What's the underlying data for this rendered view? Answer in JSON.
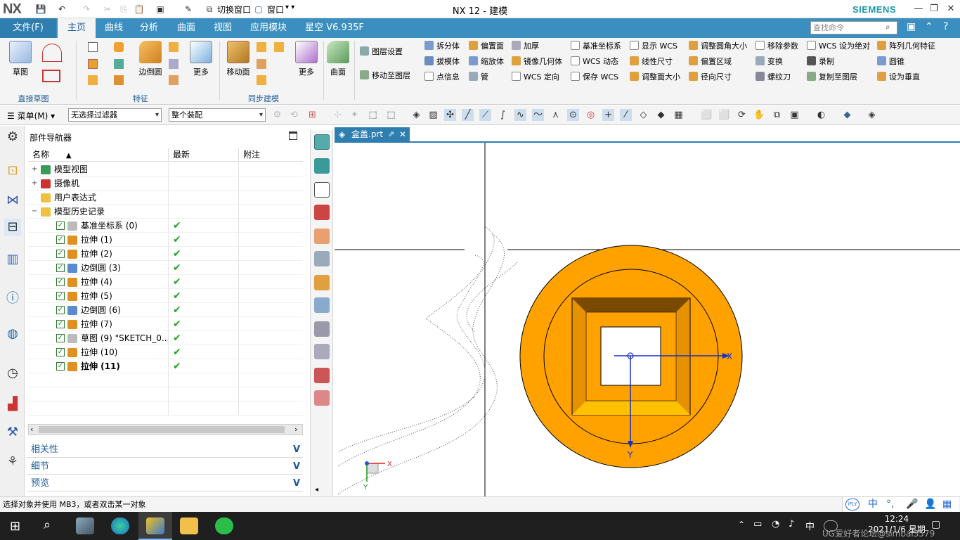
{
  "app": {
    "logo": "NX",
    "title": "NX 12 - 建模",
    "brand": "SIEMENS",
    "switch_window": "切换窗口",
    "window_menu": "窗口"
  },
  "tabs": [
    {
      "label": "文件(F)"
    },
    {
      "label": "主页"
    },
    {
      "label": "曲线"
    },
    {
      "label": "分析"
    },
    {
      "label": "曲面"
    },
    {
      "label": "视图"
    },
    {
      "label": "应用模块"
    },
    {
      "label": "星空 V6.935F"
    }
  ],
  "search": {
    "placeholder": "查找命令"
  },
  "ribbon": {
    "sketch": "草图",
    "edge_blend": "边倒圆",
    "more1": "更多",
    "move_face": "移动面",
    "more2": "更多",
    "surface": "曲面",
    "layer_settings": "图层设置",
    "move_to_layer": "移动至图层",
    "groups": {
      "direct_sketch": "直接草图",
      "feature": "特征",
      "sync_modeling": "同步建模"
    },
    "col1": [
      "拆分体",
      "拔模体",
      "点信息"
    ],
    "col2": [
      "偏置面",
      "缩放体",
      "管"
    ],
    "col3": [
      "加厚",
      "镜像几何体",
      "WCS 定向"
    ],
    "col4": [
      "基准坐标系",
      "WCS 动态",
      "保存 WCS"
    ],
    "col5": [
      "显示 WCS",
      "线性尺寸",
      "调整面大小"
    ],
    "col6": [
      "调整圆角大小",
      "偏置区域",
      "径向尺寸"
    ],
    "col7": [
      "移除参数",
      "变换",
      "螺纹刀"
    ],
    "col8": [
      "WCS 设为绝对",
      "录制",
      "复制至图层"
    ],
    "col9": [
      "阵列几何特征",
      "圆锥",
      "设为垂直"
    ]
  },
  "toolbar2": {
    "menu": "菜单(M)",
    "filter": "无选择过滤器",
    "assembly": "整个装配"
  },
  "navigator": {
    "title": "部件导航器",
    "columns": [
      "名称",
      "最新",
      "附注"
    ],
    "rows": [
      {
        "label": "模型视图",
        "level": 0,
        "expander": "+",
        "check": false,
        "latest": false,
        "bold": false
      },
      {
        "label": "摄像机",
        "level": 0,
        "expander": "+",
        "check": false,
        "latest": false,
        "bold": false
      },
      {
        "label": "用户表达式",
        "level": 0,
        "expander": "",
        "check": false,
        "latest": false,
        "bold": false
      },
      {
        "label": "模型历史记录",
        "level": 0,
        "expander": "−",
        "check": false,
        "latest": false,
        "bold": false
      },
      {
        "label": "基准坐标系 (0)",
        "level": 1,
        "expander": "",
        "check": true,
        "latest": true,
        "bold": false
      },
      {
        "label": "拉伸 (1)",
        "level": 1,
        "expander": "",
        "check": true,
        "latest": true,
        "bold": false
      },
      {
        "label": "拉伸 (2)",
        "level": 1,
        "expander": "",
        "check": true,
        "latest": true,
        "bold": false
      },
      {
        "label": "边倒圆 (3)",
        "level": 1,
        "expander": "",
        "check": true,
        "latest": true,
        "bold": false
      },
      {
        "label": "拉伸 (4)",
        "level": 1,
        "expander": "",
        "check": true,
        "latest": true,
        "bold": false
      },
      {
        "label": "拉伸 (5)",
        "level": 1,
        "expander": "",
        "check": true,
        "latest": true,
        "bold": false
      },
      {
        "label": "边倒圆 (6)",
        "level": 1,
        "expander": "",
        "check": true,
        "latest": true,
        "bold": false
      },
      {
        "label": "拉伸 (7)",
        "level": 1,
        "expander": "",
        "check": true,
        "latest": true,
        "bold": false
      },
      {
        "label": "草图 (9) \"SKETCH_0...",
        "level": 1,
        "expander": "",
        "check": true,
        "latest": true,
        "bold": false
      },
      {
        "label": "拉伸 (10)",
        "level": 1,
        "expander": "",
        "check": true,
        "latest": true,
        "bold": false
      },
      {
        "label": "拉伸 (11)",
        "level": 1,
        "expander": "",
        "check": true,
        "latest": true,
        "bold": true
      }
    ],
    "panels": [
      "相关性",
      "细节",
      "预览"
    ]
  },
  "graphics": {
    "tab": "盒盖.prt",
    "axis_x": "X",
    "axis_y": "Y",
    "triad_x": "X",
    "triad_y": "Y",
    "part_color": "#FFA200"
  },
  "status": "选择对象并使用 MB3，或者双击某一对象",
  "taskbar": {
    "time": "12:24",
    "date": "2021/1/6 星期",
    "overlay": "UG爱好者论坛@simbal3579",
    "ime": "中"
  },
  "colors": {
    "accent": "#3A8FC0",
    "tab_active": "#1A5A96",
    "check_green": "#1FA51F"
  }
}
